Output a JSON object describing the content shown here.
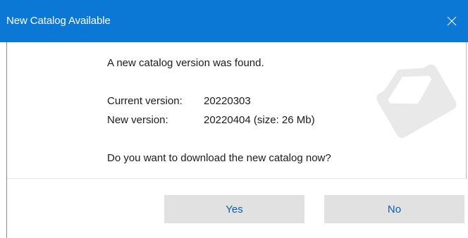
{
  "dialog": {
    "title": "New Catalog Available",
    "close_label": "✕"
  },
  "message": {
    "intro": "A new catalog version was found.",
    "current_label": "Current version:",
    "current_value": "20220303",
    "new_label": "New version:",
    "new_value": "20220404 (size: 26 Mb)",
    "question": "Do you want to download the new catalog now?"
  },
  "buttons": {
    "yes_label": "Yes",
    "no_label": "No"
  },
  "icons": {
    "watermark": "envelope-icon",
    "close": "close-icon"
  },
  "colors": {
    "titlebar": "#0a78d4",
    "button_bg": "#e1e1e1",
    "button_text": "#0a5fb4"
  }
}
